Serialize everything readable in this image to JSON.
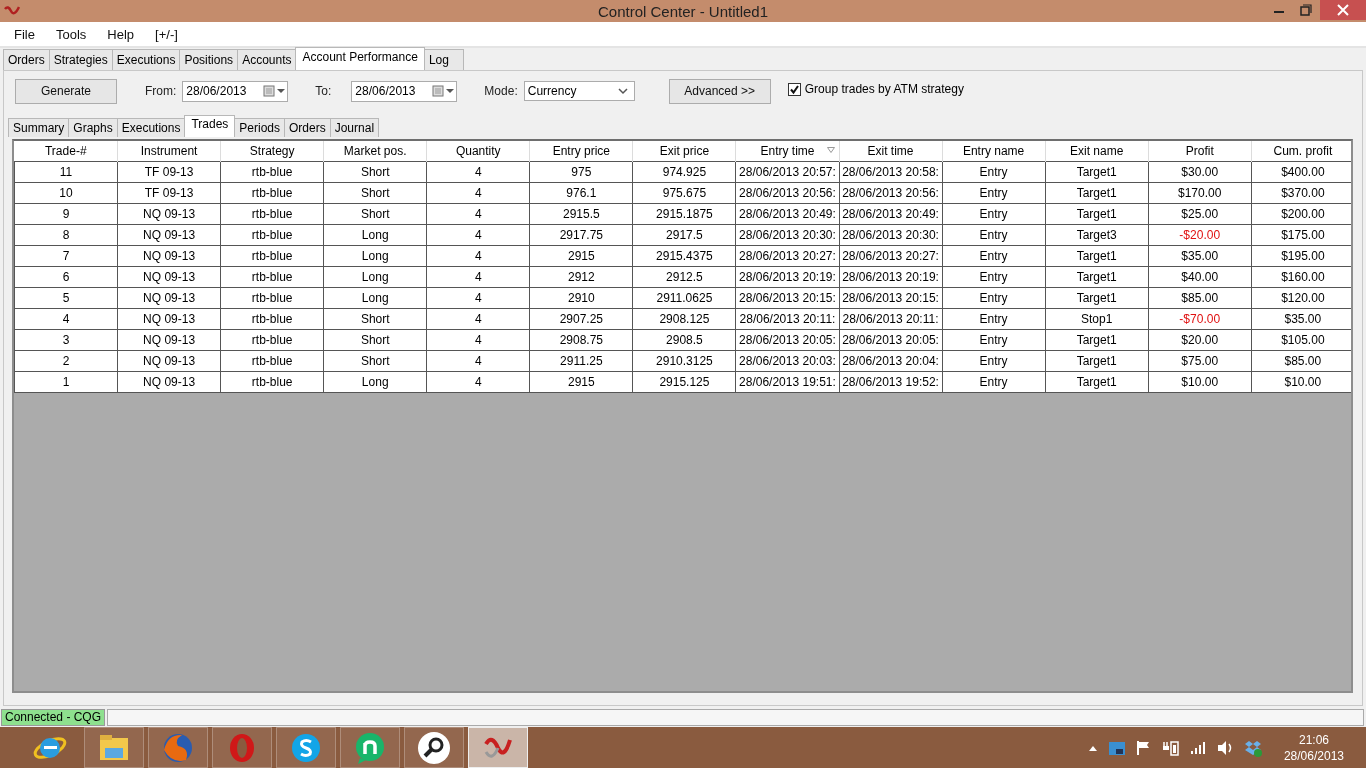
{
  "window": {
    "title": "Control Center - Untitled1"
  },
  "menu": [
    "File",
    "Tools",
    "Help",
    "[+/-]"
  ],
  "tabs": [
    {
      "label": "Orders",
      "selected": false
    },
    {
      "label": "Strategies",
      "selected": false
    },
    {
      "label": "Executions",
      "selected": false
    },
    {
      "label": "Positions",
      "selected": false
    },
    {
      "label": "Accounts",
      "selected": false
    },
    {
      "label": "Account Performance",
      "selected": true
    },
    {
      "label": "Log",
      "selected": false
    }
  ],
  "toolbar": {
    "generate": "Generate",
    "from_label": "From:",
    "from": "28/06/2013",
    "to_label": "To:",
    "to": "28/06/2013",
    "mode_label": "Mode:",
    "mode": "Currency",
    "advanced": "Advanced >>",
    "group": {
      "label": "Group trades by ATM strategy",
      "checked": true
    }
  },
  "subtabs": [
    {
      "label": "Summary",
      "selected": false
    },
    {
      "label": "Graphs",
      "selected": false
    },
    {
      "label": "Executions",
      "selected": false
    },
    {
      "label": "Trades",
      "selected": true
    },
    {
      "label": "Periods",
      "selected": false
    },
    {
      "label": "Orders",
      "selected": false
    },
    {
      "label": "Journal",
      "selected": false
    }
  ],
  "table": {
    "columns": [
      {
        "label": "Trade-#",
        "sorted": false
      },
      {
        "label": "Instrument",
        "sorted": false
      },
      {
        "label": "Strategy",
        "sorted": false
      },
      {
        "label": "Market pos.",
        "sorted": false
      },
      {
        "label": "Quantity",
        "sorted": false
      },
      {
        "label": "Entry price",
        "sorted": false
      },
      {
        "label": "Exit price",
        "sorted": false
      },
      {
        "label": "Entry time",
        "sorted": true
      },
      {
        "label": "Exit time",
        "sorted": false
      },
      {
        "label": "Entry name",
        "sorted": false
      },
      {
        "label": "Exit name",
        "sorted": false
      },
      {
        "label": "Profit",
        "sorted": false
      },
      {
        "label": "Cum. profit",
        "sorted": false
      }
    ],
    "rows": [
      {
        "cells": [
          "11",
          "TF 09-13",
          "rtb-blue",
          "Short",
          "4",
          "975",
          "974.925",
          "28/06/2013 20:57:",
          "28/06/2013 20:58:",
          "Entry",
          "Target1",
          "$30.00",
          "$400.00"
        ],
        "loss": false
      },
      {
        "cells": [
          "10",
          "TF 09-13",
          "rtb-blue",
          "Short",
          "4",
          "976.1",
          "975.675",
          "28/06/2013 20:56:",
          "28/06/2013 20:56:",
          "Entry",
          "Target1",
          "$170.00",
          "$370.00"
        ],
        "loss": false
      },
      {
        "cells": [
          "9",
          "NQ 09-13",
          "rtb-blue",
          "Short",
          "4",
          "2915.5",
          "2915.1875",
          "28/06/2013 20:49:",
          "28/06/2013 20:49:",
          "Entry",
          "Target1",
          "$25.00",
          "$200.00"
        ],
        "loss": false
      },
      {
        "cells": [
          "8",
          "NQ 09-13",
          "rtb-blue",
          "Long",
          "4",
          "2917.75",
          "2917.5",
          "28/06/2013 20:30:",
          "28/06/2013 20:30:",
          "Entry",
          "Target3",
          "-$20.00",
          "$175.00"
        ],
        "loss": true
      },
      {
        "cells": [
          "7",
          "NQ 09-13",
          "rtb-blue",
          "Long",
          "4",
          "2915",
          "2915.4375",
          "28/06/2013 20:27:",
          "28/06/2013 20:27:",
          "Entry",
          "Target1",
          "$35.00",
          "$195.00"
        ],
        "loss": false
      },
      {
        "cells": [
          "6",
          "NQ 09-13",
          "rtb-blue",
          "Long",
          "4",
          "2912",
          "2912.5",
          "28/06/2013 20:19:",
          "28/06/2013 20:19:",
          "Entry",
          "Target1",
          "$40.00",
          "$160.00"
        ],
        "loss": false
      },
      {
        "cells": [
          "5",
          "NQ 09-13",
          "rtb-blue",
          "Long",
          "4",
          "2910",
          "2911.0625",
          "28/06/2013 20:15:",
          "28/06/2013 20:15:",
          "Entry",
          "Target1",
          "$85.00",
          "$120.00"
        ],
        "loss": false
      },
      {
        "cells": [
          "4",
          "NQ 09-13",
          "rtb-blue",
          "Short",
          "4",
          "2907.25",
          "2908.125",
          "28/06/2013 20:11:",
          "28/06/2013 20:11:",
          "Entry",
          "Stop1",
          "-$70.00",
          "$35.00"
        ],
        "loss": true
      },
      {
        "cells": [
          "3",
          "NQ 09-13",
          "rtb-blue",
          "Short",
          "4",
          "2908.75",
          "2908.5",
          "28/06/2013 20:05:",
          "28/06/2013 20:05:",
          "Entry",
          "Target1",
          "$20.00",
          "$105.00"
        ],
        "loss": false
      },
      {
        "cells": [
          "2",
          "NQ 09-13",
          "rtb-blue",
          "Short",
          "4",
          "2911.25",
          "2910.3125",
          "28/06/2013 20:03:",
          "28/06/2013 20:04:",
          "Entry",
          "Target1",
          "$75.00",
          "$85.00"
        ],
        "loss": false
      },
      {
        "cells": [
          "1",
          "NQ 09-13",
          "rtb-blue",
          "Long",
          "4",
          "2915",
          "2915.125",
          "28/06/2013 19:51:",
          "28/06/2013 19:52:",
          "Entry",
          "Target1",
          "$10.00",
          "$10.00"
        ],
        "loss": false
      }
    ]
  },
  "status_bar": {
    "connection": "Connected - CQG",
    "connected": true
  },
  "taskbar": {
    "apps": [
      {
        "kind": "browser-e",
        "selected": false
      },
      {
        "kind": "folder",
        "selected": false
      },
      {
        "kind": "fox",
        "selected": false
      },
      {
        "kind": "ring",
        "selected": false
      },
      {
        "kind": "chat-s",
        "selected": false
      },
      {
        "kind": "bubble-n",
        "selected": false
      },
      {
        "kind": "magnifier",
        "selected": false
      },
      {
        "kind": "app-logo",
        "selected": true
      }
    ],
    "time": "21:06",
    "date": "28/06/2013"
  }
}
